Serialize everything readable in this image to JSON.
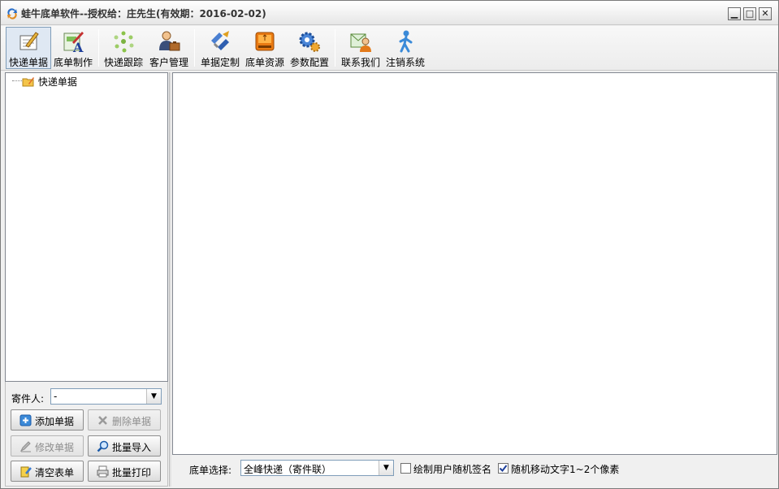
{
  "window": {
    "title": "蛙牛底单软件--授权给：庄先生(有效期：2016-02-02)",
    "minimize": "▁",
    "maximize": "□",
    "close": "✕"
  },
  "toolbar": {
    "items": [
      {
        "label": "快递单据",
        "icon": "express-form-icon",
        "active": true
      },
      {
        "label": "底单制作",
        "icon": "template-make-icon"
      },
      {
        "label": "快递跟踪",
        "icon": "tracking-icon"
      },
      {
        "label": "客户管理",
        "icon": "customer-icon"
      },
      {
        "label": "单据定制",
        "icon": "form-custom-icon"
      },
      {
        "label": "底单资源",
        "icon": "resource-icon"
      },
      {
        "label": "参数配置",
        "icon": "gear-icon"
      },
      {
        "label": "联系我们",
        "icon": "contact-icon"
      },
      {
        "label": "注销系统",
        "icon": "logout-icon"
      }
    ]
  },
  "tree": {
    "root_label": "快递单据"
  },
  "sender": {
    "label": "寄件人:",
    "value": "-"
  },
  "buttons": {
    "add": "添加单据",
    "delete": "删除单据",
    "edit": "修改单据",
    "import": "批量导入",
    "clear": "清空表单",
    "print": "批量打印"
  },
  "bottom": {
    "template_label": "底单选择:",
    "template_value": "全峰快递（寄件联）",
    "random_signature_label": "绘制用户随机签名",
    "random_signature_checked": false,
    "random_move_label": "随机移动文字1~2个像素",
    "random_move_checked": true
  }
}
